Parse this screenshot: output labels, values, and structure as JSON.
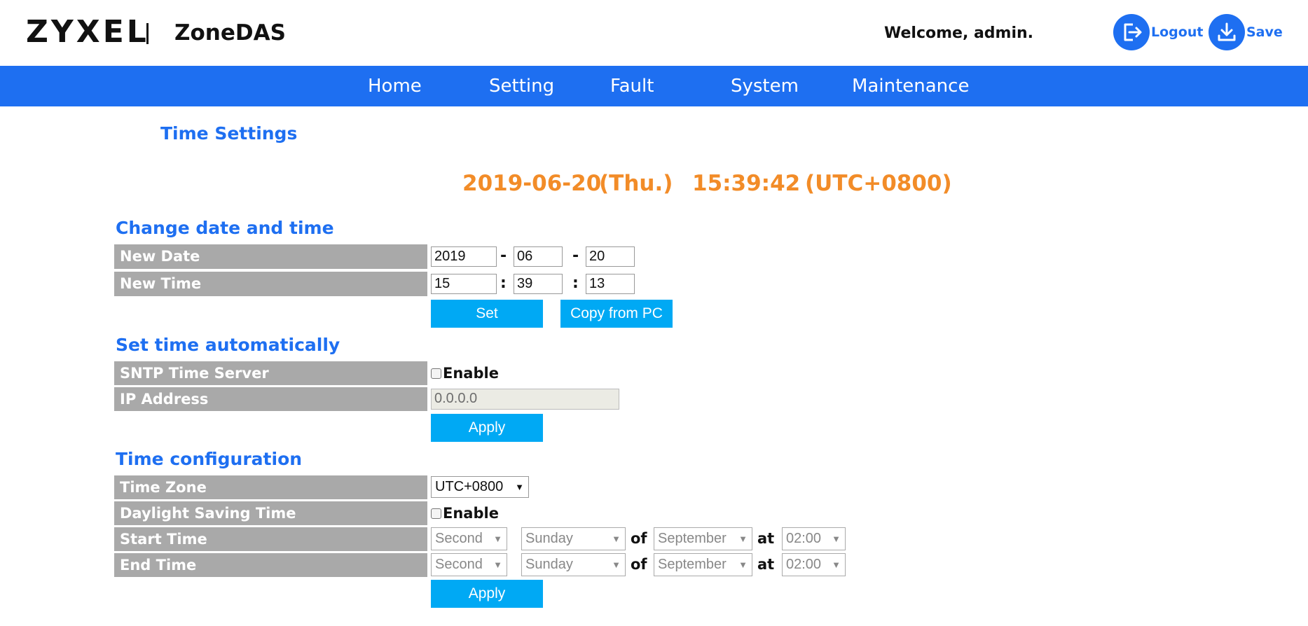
{
  "header": {
    "logo": "ZYXEL",
    "product": "ZoneDAS",
    "welcome": "Welcome, admin.",
    "logout_label": "Logout",
    "save_label": "Save"
  },
  "nav": {
    "items": [
      "Home",
      "Setting",
      "Fault",
      "System",
      "Maintenance"
    ]
  },
  "page_title": "Time Settings",
  "clock": {
    "date": "2019-06-20",
    "day": "(Thu.)",
    "time": "15:39:42",
    "tz": "(UTC+0800)"
  },
  "change_date_time": {
    "title": "Change date and time",
    "new_date_label": "New Date",
    "new_time_label": "New Time",
    "year": "2019",
    "month": "06",
    "day": "20",
    "hour": "15",
    "minute": "39",
    "second": "13",
    "date_sep": "-",
    "time_sep": ":",
    "set_label": "Set",
    "copy_label": "Copy from PC"
  },
  "auto_time": {
    "title": "Set time automatically",
    "sntp_label": "SNTP Time Server",
    "enable_label": "Enable",
    "ip_label": "IP Address",
    "ip_value": "0.0.0.0",
    "apply_label": "Apply"
  },
  "time_config": {
    "title": "Time configuration",
    "timezone_label": "Time Zone",
    "timezone_value": "UTC+0800",
    "dst_label": "Daylight Saving Time",
    "enable_label": "Enable",
    "start_label": "Start Time",
    "end_label": "End Time",
    "of_label": "of",
    "at_label": "at",
    "start": {
      "week": "Second",
      "weekday": "Sunday",
      "month": "September",
      "time": "02:00"
    },
    "end": {
      "week": "Second",
      "weekday": "Sunday",
      "month": "September",
      "time": "02:00"
    },
    "apply_label": "Apply"
  },
  "colors": {
    "brand_blue": "#1e6ff1",
    "button_blue": "#00a9f4",
    "clock_orange": "#f28c28",
    "label_gray": "#a9a9a9"
  },
  "icons": {
    "logout": "logout-icon",
    "save": "download-icon"
  }
}
